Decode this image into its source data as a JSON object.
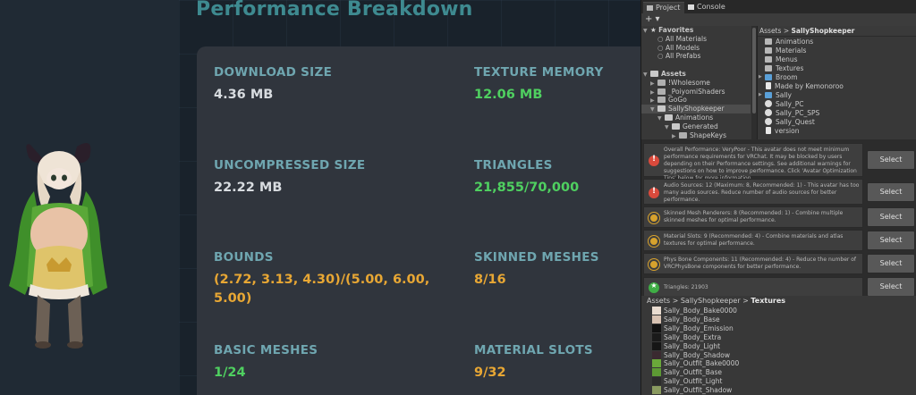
{
  "performance": {
    "title": "Performance Breakdown",
    "stats": [
      {
        "label": "DOWNLOAD SIZE",
        "value": "4.36 MB",
        "tone": "white"
      },
      {
        "label": "TEXTURE MEMORY",
        "value": "12.06 MB",
        "tone": "green"
      },
      {
        "label": "UNCOMPRESSED SIZE",
        "value": "22.22 MB",
        "tone": "white"
      },
      {
        "label": "TRIANGLES",
        "value": "21,855/70,000",
        "tone": "green"
      },
      {
        "label": "BOUNDS",
        "value": "(2.72, 3.13, 4.30)/(5.00, 6.00, 5.00)",
        "tone": "orange"
      },
      {
        "label": "SKINNED MESHES",
        "value": "8/16",
        "tone": "orange"
      },
      {
        "label": "BASIC MESHES",
        "value": "1/24",
        "tone": "green"
      },
      {
        "label": "MATERIAL SLOTS",
        "value": "9/32",
        "tone": "orange"
      }
    ]
  },
  "unity": {
    "tabs": [
      {
        "label": "Project",
        "icon": "folder-icon"
      },
      {
        "label": "Console",
        "icon": "console-icon"
      }
    ],
    "add_button": "+ ▾",
    "tree": [
      {
        "label": "Favorites",
        "depth": 0,
        "kind": "star",
        "expanded": true
      },
      {
        "label": "All Materials",
        "depth": 1,
        "kind": "search"
      },
      {
        "label": "All Models",
        "depth": 1,
        "kind": "search"
      },
      {
        "label": "All Prefabs",
        "depth": 1,
        "kind": "search"
      },
      {
        "label": "",
        "depth": 0,
        "kind": "spacer"
      },
      {
        "label": "Assets",
        "depth": 0,
        "kind": "folder",
        "expanded": true
      },
      {
        "label": "!Wholesome",
        "depth": 1,
        "kind": "folder"
      },
      {
        "label": "_PoiyomiShaders",
        "depth": 1,
        "kind": "folder"
      },
      {
        "label": "GoGo",
        "depth": 1,
        "kind": "folder"
      },
      {
        "label": "SallyShopkeeper",
        "depth": 1,
        "kind": "folder",
        "expanded": true,
        "selected": true
      },
      {
        "label": "Animations",
        "depth": 2,
        "kind": "folder",
        "expanded": true
      },
      {
        "label": "Generated",
        "depth": 3,
        "kind": "folder",
        "expanded": true
      },
      {
        "label": "ShapeKeys",
        "depth": 4,
        "kind": "folder"
      }
    ],
    "assets_breadcrumb": {
      "root": "Assets",
      "sep": ">",
      "current": "SallyShopkeeper"
    },
    "assets_items": [
      {
        "label": "Animations",
        "kind": "folder"
      },
      {
        "label": "Materials",
        "kind": "folder"
      },
      {
        "label": "Menus",
        "kind": "folder"
      },
      {
        "label": "Textures",
        "kind": "folder"
      },
      {
        "label": "Broom",
        "kind": "prefab",
        "arrow": true
      },
      {
        "label": "Made by Kemonoroo",
        "kind": "file"
      },
      {
        "label": "Sally",
        "kind": "prefab",
        "arrow": true
      },
      {
        "label": "Sally_PC",
        "kind": "gear"
      },
      {
        "label": "Sally_PC_SPS",
        "kind": "gear"
      },
      {
        "label": "Sally_Quest",
        "kind": "gear"
      },
      {
        "label": "version",
        "kind": "file"
      }
    ],
    "warnings": [
      {
        "level": "error",
        "text": "Overall Performance: VeryPoor - This avatar does not meet minimum performance requirements for VRChat. It may be blocked by users depending on their Performance settings. See additional warnings for suggestions on how to improve performance. Click 'Avatar Optimization Tips' below for more information.",
        "button": "Select"
      },
      {
        "level": "error",
        "text": "Audio Sources: 12 (Maximum: 8, Recommended: 1) - This avatar has too many audio sources. Reduce number of audio sources for better performance.",
        "button": "Select"
      },
      {
        "level": "warning",
        "text": "Skinned Mesh Renderers: 8 (Recommended: 1) - Combine multiple skinned meshes for optimal performance.",
        "button": "Select"
      },
      {
        "level": "warning",
        "text": "Material Slots: 9 (Recommended: 4) - Combine materials and atlas textures for optimal performance.",
        "button": "Select"
      },
      {
        "level": "warning",
        "text": "Phys Bone Components: 11 (Recommended: 4) - Reduce the number of VRCPhysBone components for better performance.",
        "button": "Select"
      },
      {
        "level": "good",
        "text": "Triangles: 21903",
        "button": "Select"
      }
    ],
    "texture_breadcrumb": {
      "root": "Assets",
      "mid": "SallyShopkeeper",
      "current": "Textures",
      "sep": ">"
    },
    "textures": [
      {
        "label": "Sally_Body_Bake0000",
        "swatch": "#e9dcd0"
      },
      {
        "label": "Sally_Body_Base",
        "swatch": "#d8c2b2"
      },
      {
        "label": "Sally_Body_Emission",
        "swatch": "#111111"
      },
      {
        "label": "Sally_Body_Extra",
        "swatch": "#1a1a1a"
      },
      {
        "label": "Sally_Body_Light",
        "swatch": "#151515"
      },
      {
        "label": "Sally_Body_Shadow",
        "swatch": "#3a2a30"
      },
      {
        "label": "Sally_Outfit_Bake0000",
        "swatch": "#6aa83a"
      },
      {
        "label": "Sally_Outfit_Base",
        "swatch": "#5d9a34"
      },
      {
        "label": "Sally_Outfit_Light",
        "swatch": "#2c2c2c"
      },
      {
        "label": "Sally_Outfit_Shadow",
        "swatch": "#8a9a60"
      }
    ]
  },
  "colors": {
    "title": "#3e8a90",
    "label": "#6fa6b0",
    "good": "#4fd060",
    "medium": "#e8a734",
    "neutral": "#d8dce0"
  }
}
